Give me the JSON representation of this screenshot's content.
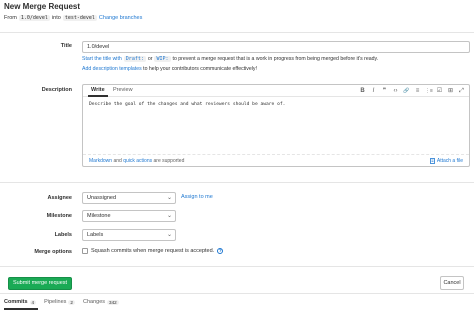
{
  "header": {
    "title": "New Merge Request",
    "from_label": "From",
    "source_branch": "1.0/devel",
    "into_label": "into",
    "target_branch": "test-devel",
    "change_branches": "Change branches"
  },
  "form": {
    "title_label": "Title",
    "title_value": "1.0/devel",
    "hint_start": "Start the title with",
    "hint_draft": "Draft:",
    "hint_or": "or",
    "hint_wip": "WIP:",
    "hint_rest": "to prevent a merge request that is a work in progress from being merged before it's ready.",
    "hint2_link": "Add description templates",
    "hint2_rest": "to help your contributors communicate effectively!",
    "description_label": "Description",
    "tab_write": "Write",
    "tab_preview": "Preview",
    "toolbar": [
      "B",
      "I",
      "❞",
      "‹›",
      "🔗",
      "≡",
      "⋮≡",
      "☑",
      "⊞",
      "⤢"
    ],
    "description_placeholder": "Describe the goal of the changes and what reviewers should be aware of.",
    "md_markdown": "Markdown",
    "md_and": "and",
    "md_quick_actions": "quick actions",
    "md_supported": "are supported",
    "attach_file": "Attach a file",
    "assignee_label": "Assignee",
    "assignee_value": "Unassigned",
    "assign_to_me": "Assign to me",
    "milestone_label": "Milestone",
    "milestone_value": "Milestone",
    "labels_label": "Labels",
    "labels_value": "Labels",
    "merge_options_label": "Merge options",
    "squash_label": "Squash commits when merge request is accepted."
  },
  "actions": {
    "submit": "Submit merge request",
    "cancel": "Cancel"
  },
  "bottom_tabs": [
    {
      "label": "Commits",
      "count": "4"
    },
    {
      "label": "Pipelines",
      "count": "2"
    },
    {
      "label": "Changes",
      "count": "342"
    }
  ],
  "colors": {
    "link": "#1f78d1",
    "submit": "#1aaa55"
  }
}
